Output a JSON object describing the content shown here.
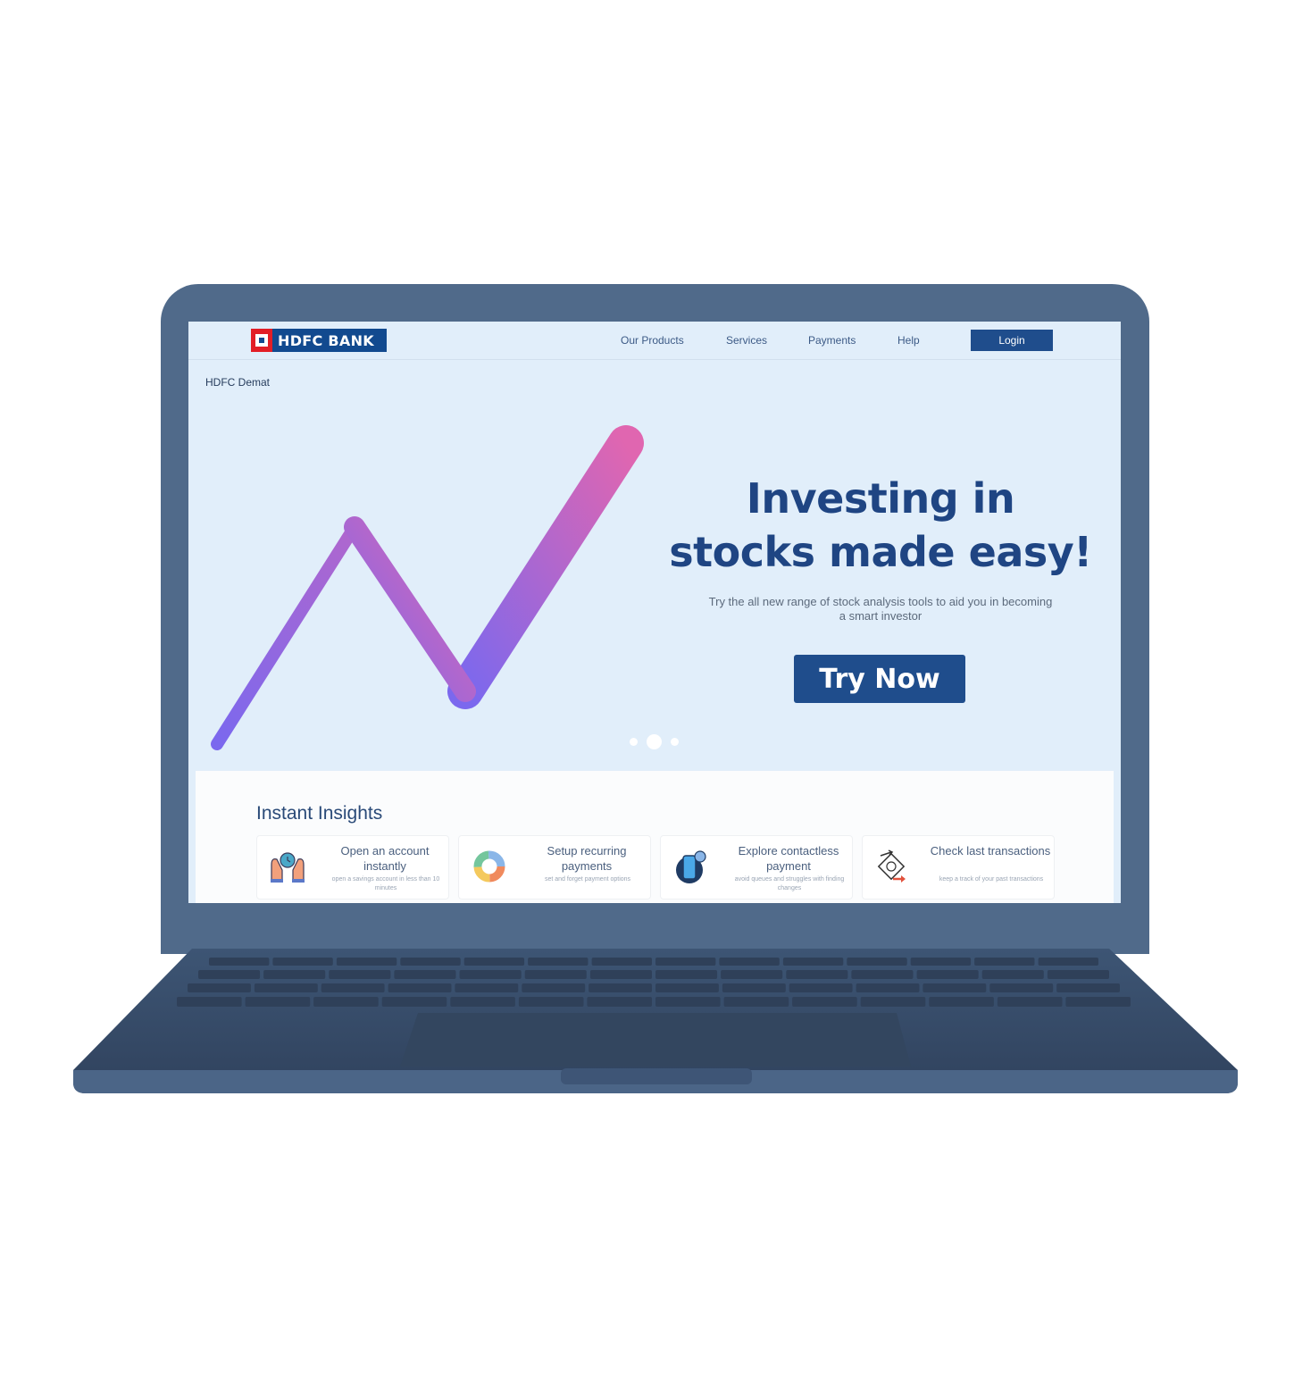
{
  "brand": {
    "name": "HDFC BANK"
  },
  "nav": {
    "links": [
      "Our Products",
      "Services",
      "Payments",
      "Help"
    ],
    "login_label": "Login"
  },
  "breadcrumb": "HDFC Demat",
  "hero": {
    "title_line1": "Investing in",
    "title_line2": "stocks made easy!",
    "subtitle": "Try the all new range of stock analysis tools to aid you in becoming a smart investor",
    "cta_label": "Try Now",
    "carousel": {
      "total_slides": 3,
      "active_slide": 2
    }
  },
  "insights": {
    "title": "Instant Insights",
    "cards": [
      {
        "icon": "hands-clock-icon",
        "title": "Open an account instantly",
        "desc": "open a savings account in less than 10 minutes"
      },
      {
        "icon": "donut-chart-icon",
        "title": "Setup recurring payments",
        "desc": "set and forget payment options"
      },
      {
        "icon": "phone-payment-icon",
        "title": "Explore contactless payment",
        "desc": "avoid queues and struggles with finding changes"
      },
      {
        "icon": "money-transfer-icon",
        "title": "Check last transactions",
        "desc": "keep a track of your past transactions"
      }
    ]
  },
  "colors": {
    "primary": "#1f4d8c",
    "laptop_body": "#506a8a",
    "screen_bg": "#e1eefa",
    "trend_start": "#7b68ee",
    "trend_end": "#e066b0"
  }
}
